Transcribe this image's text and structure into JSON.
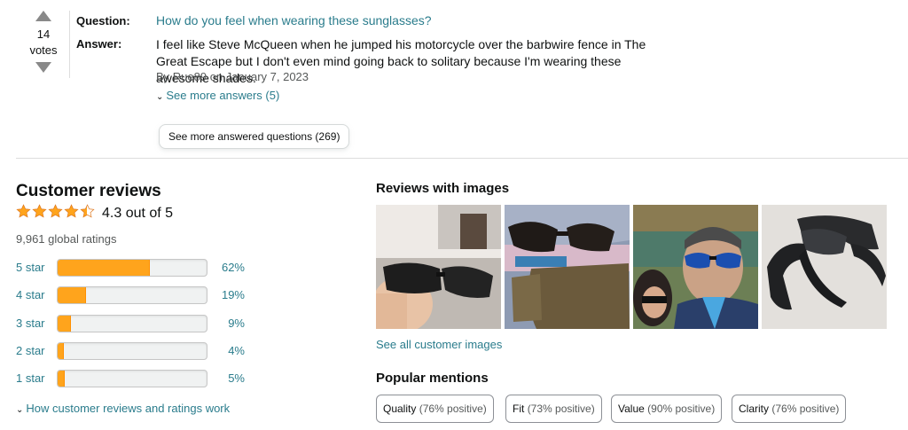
{
  "qa": {
    "votes_count": "14",
    "votes_label": "votes",
    "question_label": "Question:",
    "question_text": "How do you feel when wearing these sunglasses?",
    "answer_label": "Answer:",
    "answer_text": "I feel like Steve McQueen when he jumped his motorcycle over the barbwire fence in The Great Escape but I don't even mind going back to solitary because I'm wearing these awesome shades.",
    "answer_byline": "By Rue89 on January 7, 2023",
    "see_more_answers": "See more answers (5)",
    "see_more_questions": "See more answered questions (269)"
  },
  "reviews": {
    "title": "Customer reviews",
    "rating_text": "4.3 out of 5",
    "rating_value": 4.3,
    "global_ratings": "9,961 global ratings",
    "histogram": [
      {
        "label": "5 star",
        "pct": "62%",
        "value": 62
      },
      {
        "label": "4 star",
        "pct": "19%",
        "value": 19
      },
      {
        "label": "3 star",
        "pct": "9%",
        "value": 9
      },
      {
        "label": "2 star",
        "pct": "4%",
        "value": 4
      },
      {
        "label": "1 star",
        "pct": "5%",
        "value": 5
      }
    ],
    "how_link": "How customer reviews and ratings work"
  },
  "images": {
    "title": "Reviews with images",
    "see_all": "See all customer images",
    "thumbnails": [
      "review-photo-hand-holding-sunglasses",
      "review-photo-sunglasses-with-pouch",
      "review-photo-selfie-couple",
      "review-photo-sunglasses-on-table"
    ]
  },
  "mentions": {
    "title": "Popular mentions",
    "items": [
      {
        "name": "Quality",
        "detail": "(76% positive)"
      },
      {
        "name": "Fit",
        "detail": "(73% positive)"
      },
      {
        "name": "Value",
        "detail": "(90% positive)"
      },
      {
        "name": "Clarity",
        "detail": "(76% positive)"
      }
    ]
  },
  "colors": {
    "link": "#2a7c8c",
    "star": "#ffa41c",
    "bar_fill": "#ffa41c",
    "bar_bg": "#f0f2f2"
  },
  "icons": [
    "upvote-arrow-icon",
    "downvote-arrow-icon",
    "chevron-down-icon",
    "star-icon"
  ]
}
